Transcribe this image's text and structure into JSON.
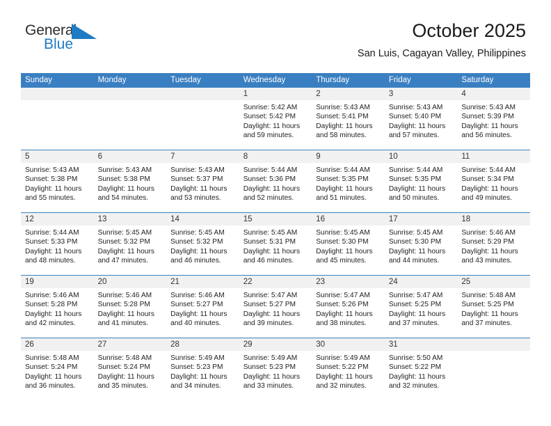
{
  "brand": {
    "name_part1": "General",
    "name_part2": "Blue",
    "triangle_icon": "triangle-right-icon",
    "color_dark": "#2b2b2b",
    "color_blue": "#1f7bc4"
  },
  "header": {
    "title": "October 2025",
    "subtitle": "San Luis, Cagayan Valley, Philippines"
  },
  "theme": {
    "header_bg": "#3a7fc1",
    "daynum_bg": "#f1f1f1",
    "row_divider": "#3a7fc1"
  },
  "weekdays": [
    "Sunday",
    "Monday",
    "Tuesday",
    "Wednesday",
    "Thursday",
    "Friday",
    "Saturday"
  ],
  "labels": {
    "sunrise_prefix": "Sunrise:",
    "sunset_prefix": "Sunset:",
    "daylight_prefix": "Daylight:"
  },
  "weeks": [
    [
      {
        "day": "",
        "empty": true,
        "sunrise": "",
        "sunset": "",
        "daylight": ""
      },
      {
        "day": "",
        "empty": true,
        "sunrise": "",
        "sunset": "",
        "daylight": ""
      },
      {
        "day": "",
        "empty": true,
        "sunrise": "",
        "sunset": "",
        "daylight": ""
      },
      {
        "day": "1",
        "empty": false,
        "sunrise": "Sunrise: 5:42 AM",
        "sunset": "Sunset: 5:42 PM",
        "daylight": "Daylight: 11 hours and 59 minutes."
      },
      {
        "day": "2",
        "empty": false,
        "sunrise": "Sunrise: 5:43 AM",
        "sunset": "Sunset: 5:41 PM",
        "daylight": "Daylight: 11 hours and 58 minutes."
      },
      {
        "day": "3",
        "empty": false,
        "sunrise": "Sunrise: 5:43 AM",
        "sunset": "Sunset: 5:40 PM",
        "daylight": "Daylight: 11 hours and 57 minutes."
      },
      {
        "day": "4",
        "empty": false,
        "sunrise": "Sunrise: 5:43 AM",
        "sunset": "Sunset: 5:39 PM",
        "daylight": "Daylight: 11 hours and 56 minutes."
      }
    ],
    [
      {
        "day": "5",
        "empty": false,
        "sunrise": "Sunrise: 5:43 AM",
        "sunset": "Sunset: 5:38 PM",
        "daylight": "Daylight: 11 hours and 55 minutes."
      },
      {
        "day": "6",
        "empty": false,
        "sunrise": "Sunrise: 5:43 AM",
        "sunset": "Sunset: 5:38 PM",
        "daylight": "Daylight: 11 hours and 54 minutes."
      },
      {
        "day": "7",
        "empty": false,
        "sunrise": "Sunrise: 5:43 AM",
        "sunset": "Sunset: 5:37 PM",
        "daylight": "Daylight: 11 hours and 53 minutes."
      },
      {
        "day": "8",
        "empty": false,
        "sunrise": "Sunrise: 5:44 AM",
        "sunset": "Sunset: 5:36 PM",
        "daylight": "Daylight: 11 hours and 52 minutes."
      },
      {
        "day": "9",
        "empty": false,
        "sunrise": "Sunrise: 5:44 AM",
        "sunset": "Sunset: 5:35 PM",
        "daylight": "Daylight: 11 hours and 51 minutes."
      },
      {
        "day": "10",
        "empty": false,
        "sunrise": "Sunrise: 5:44 AM",
        "sunset": "Sunset: 5:35 PM",
        "daylight": "Daylight: 11 hours and 50 minutes."
      },
      {
        "day": "11",
        "empty": false,
        "sunrise": "Sunrise: 5:44 AM",
        "sunset": "Sunset: 5:34 PM",
        "daylight": "Daylight: 11 hours and 49 minutes."
      }
    ],
    [
      {
        "day": "12",
        "empty": false,
        "sunrise": "Sunrise: 5:44 AM",
        "sunset": "Sunset: 5:33 PM",
        "daylight": "Daylight: 11 hours and 48 minutes."
      },
      {
        "day": "13",
        "empty": false,
        "sunrise": "Sunrise: 5:45 AM",
        "sunset": "Sunset: 5:32 PM",
        "daylight": "Daylight: 11 hours and 47 minutes."
      },
      {
        "day": "14",
        "empty": false,
        "sunrise": "Sunrise: 5:45 AM",
        "sunset": "Sunset: 5:32 PM",
        "daylight": "Daylight: 11 hours and 46 minutes."
      },
      {
        "day": "15",
        "empty": false,
        "sunrise": "Sunrise: 5:45 AM",
        "sunset": "Sunset: 5:31 PM",
        "daylight": "Daylight: 11 hours and 46 minutes."
      },
      {
        "day": "16",
        "empty": false,
        "sunrise": "Sunrise: 5:45 AM",
        "sunset": "Sunset: 5:30 PM",
        "daylight": "Daylight: 11 hours and 45 minutes."
      },
      {
        "day": "17",
        "empty": false,
        "sunrise": "Sunrise: 5:45 AM",
        "sunset": "Sunset: 5:30 PM",
        "daylight": "Daylight: 11 hours and 44 minutes."
      },
      {
        "day": "18",
        "empty": false,
        "sunrise": "Sunrise: 5:46 AM",
        "sunset": "Sunset: 5:29 PM",
        "daylight": "Daylight: 11 hours and 43 minutes."
      }
    ],
    [
      {
        "day": "19",
        "empty": false,
        "sunrise": "Sunrise: 5:46 AM",
        "sunset": "Sunset: 5:28 PM",
        "daylight": "Daylight: 11 hours and 42 minutes."
      },
      {
        "day": "20",
        "empty": false,
        "sunrise": "Sunrise: 5:46 AM",
        "sunset": "Sunset: 5:28 PM",
        "daylight": "Daylight: 11 hours and 41 minutes."
      },
      {
        "day": "21",
        "empty": false,
        "sunrise": "Sunrise: 5:46 AM",
        "sunset": "Sunset: 5:27 PM",
        "daylight": "Daylight: 11 hours and 40 minutes."
      },
      {
        "day": "22",
        "empty": false,
        "sunrise": "Sunrise: 5:47 AM",
        "sunset": "Sunset: 5:27 PM",
        "daylight": "Daylight: 11 hours and 39 minutes."
      },
      {
        "day": "23",
        "empty": false,
        "sunrise": "Sunrise: 5:47 AM",
        "sunset": "Sunset: 5:26 PM",
        "daylight": "Daylight: 11 hours and 38 minutes."
      },
      {
        "day": "24",
        "empty": false,
        "sunrise": "Sunrise: 5:47 AM",
        "sunset": "Sunset: 5:25 PM",
        "daylight": "Daylight: 11 hours and 37 minutes."
      },
      {
        "day": "25",
        "empty": false,
        "sunrise": "Sunrise: 5:48 AM",
        "sunset": "Sunset: 5:25 PM",
        "daylight": "Daylight: 11 hours and 37 minutes."
      }
    ],
    [
      {
        "day": "26",
        "empty": false,
        "sunrise": "Sunrise: 5:48 AM",
        "sunset": "Sunset: 5:24 PM",
        "daylight": "Daylight: 11 hours and 36 minutes."
      },
      {
        "day": "27",
        "empty": false,
        "sunrise": "Sunrise: 5:48 AM",
        "sunset": "Sunset: 5:24 PM",
        "daylight": "Daylight: 11 hours and 35 minutes."
      },
      {
        "day": "28",
        "empty": false,
        "sunrise": "Sunrise: 5:49 AM",
        "sunset": "Sunset: 5:23 PM",
        "daylight": "Daylight: 11 hours and 34 minutes."
      },
      {
        "day": "29",
        "empty": false,
        "sunrise": "Sunrise: 5:49 AM",
        "sunset": "Sunset: 5:23 PM",
        "daylight": "Daylight: 11 hours and 33 minutes."
      },
      {
        "day": "30",
        "empty": false,
        "sunrise": "Sunrise: 5:49 AM",
        "sunset": "Sunset: 5:22 PM",
        "daylight": "Daylight: 11 hours and 32 minutes."
      },
      {
        "day": "31",
        "empty": false,
        "sunrise": "Sunrise: 5:50 AM",
        "sunset": "Sunset: 5:22 PM",
        "daylight": "Daylight: 11 hours and 32 minutes."
      },
      {
        "day": "",
        "empty": true,
        "sunrise": "",
        "sunset": "",
        "daylight": ""
      }
    ]
  ]
}
